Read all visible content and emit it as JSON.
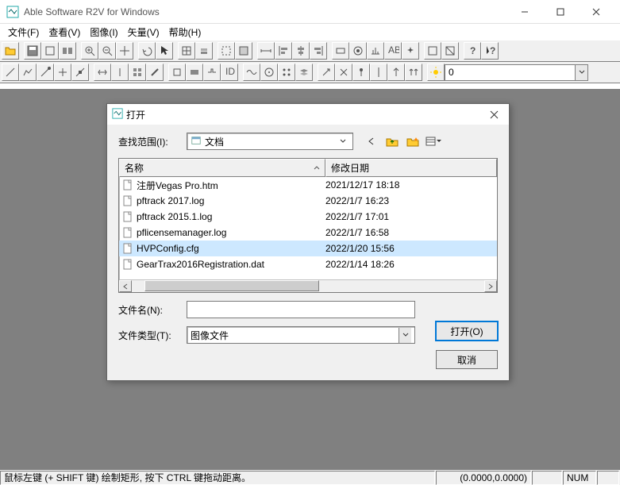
{
  "titlebar": {
    "title": "Able Software R2V for Windows"
  },
  "menubar": {
    "items": [
      "文件(F)",
      "查看(V)",
      "图像(I)",
      "矢量(V)",
      "帮助(H)"
    ]
  },
  "toolbar2": {
    "combo_value": "0"
  },
  "dialog": {
    "title": "打开",
    "lookin_label": "查找范围(I):",
    "location": "文档",
    "columns": {
      "name": "名称",
      "date": "修改日期"
    },
    "files": [
      {
        "name": "注册Vegas Pro.htm",
        "date": "2021/12/17 18:18",
        "sel": false
      },
      {
        "name": "pftrack 2017.log",
        "date": "2022/1/7 16:23",
        "sel": false
      },
      {
        "name": "pftrack 2015.1.log",
        "date": "2022/1/7 17:01",
        "sel": false
      },
      {
        "name": "pflicensemanager.log",
        "date": "2022/1/7 16:58",
        "sel": false
      },
      {
        "name": "HVPConfig.cfg",
        "date": "2022/1/20 15:56",
        "sel": true
      },
      {
        "name": "GearTrax2016Registration.dat",
        "date": "2022/1/14 18:26",
        "sel": false
      }
    ],
    "filename_label": "文件名(N):",
    "filename_value": "",
    "filetype_label": "文件类型(T):",
    "filetype_value": "图像文件",
    "open_btn": "打开(O)",
    "cancel_btn": "取消"
  },
  "statusbar": {
    "hint": "鼠标左键 (+ SHIFT 键) 绘制矩形, 按下 CTRL 键拖动距离。",
    "coords": "(0.0000,0.0000)",
    "num": "NUM"
  }
}
